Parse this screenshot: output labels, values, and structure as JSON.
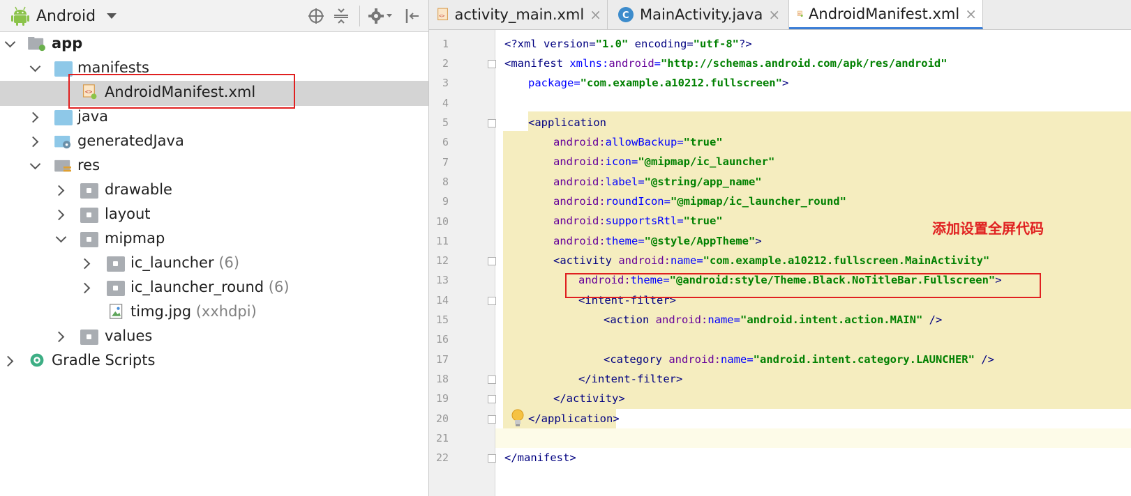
{
  "project_panel": {
    "view_label": "Android",
    "tree": [
      {
        "label": "app",
        "bold": true,
        "count": ""
      },
      {
        "label": "manifests",
        "count": ""
      },
      {
        "label": "AndroidManifest.xml",
        "count": ""
      },
      {
        "label": "java",
        "count": ""
      },
      {
        "label": "generatedJava",
        "count": ""
      },
      {
        "label": "res",
        "count": ""
      },
      {
        "label": "drawable",
        "count": ""
      },
      {
        "label": "layout",
        "count": ""
      },
      {
        "label": "mipmap",
        "count": ""
      },
      {
        "label": "ic_launcher",
        "count": "(6)"
      },
      {
        "label": "ic_launcher_round",
        "count": "(6)"
      },
      {
        "label": "timg.jpg",
        "count": "(xxhdpi)"
      },
      {
        "label": "values",
        "count": ""
      },
      {
        "label": "Gradle Scripts",
        "count": ""
      }
    ]
  },
  "editor": {
    "tabs": [
      {
        "label": "activity_main.xml",
        "close": "×"
      },
      {
        "label": "MainActivity.java",
        "close": "×"
      },
      {
        "label": "AndroidManifest.xml",
        "close": "×"
      }
    ],
    "active_tab": "AndroidManifest.xml",
    "line_numbers": [
      "1",
      "2",
      "3",
      "4",
      "5",
      "6",
      "7",
      "8",
      "9",
      "10",
      "11",
      "12",
      "13",
      "14",
      "15",
      "16",
      "17",
      "18",
      "19",
      "20",
      "21",
      "22"
    ],
    "code": {
      "l1": {
        "a": "<?xml version=",
        "b": "\"1.0\"",
        "c": " encoding=",
        "d": "\"utf-8\"",
        "e": "?>"
      },
      "l2": {
        "a": "<manifest ",
        "b": "xmlns:",
        "c": "android",
        "d": "=",
        "e": "\"http://schemas.android.com/apk/res/android\""
      },
      "l3": {
        "a": "package=",
        "b": "\"com.example.a10212.fullscreen\"",
        "c": ">"
      },
      "l5": {
        "a": "<application"
      },
      "l6": {
        "k": "android:",
        "n": "allowBackup",
        "eq": "=",
        "v": "\"true\""
      },
      "l7": {
        "k": "android:",
        "n": "icon",
        "eq": "=",
        "v": "\"@mipmap/ic_launcher\""
      },
      "l8": {
        "k": "android:",
        "n": "label",
        "eq": "=",
        "v": "\"@string/app_name\""
      },
      "l9": {
        "k": "android:",
        "n": "roundIcon",
        "eq": "=",
        "v": "\"@mipmap/ic_launcher_round\""
      },
      "l10": {
        "k": "android:",
        "n": "supportsRtl",
        "eq": "=",
        "v": "\"true\""
      },
      "l11": {
        "k": "android:",
        "n": "theme",
        "eq": "=",
        "v": "\"@style/AppTheme\"",
        "end": ">"
      },
      "l12": {
        "a": "<activity ",
        "k": "android:",
        "n": "name",
        "eq": "=",
        "v": "\"com.example.a10212.fullscreen.MainActivity\""
      },
      "l13": {
        "k": "android:",
        "n": "theme",
        "eq": "=",
        "v": "\"@android:style/Theme.Black.NoTitleBar.Fullscreen\"",
        "end": ">"
      },
      "l14": {
        "a": "<intent-filter>"
      },
      "l15": {
        "a": "<action ",
        "k": "android:",
        "n": "name",
        "eq": "=",
        "v": "\"android.intent.action.MAIN\"",
        "end": " />"
      },
      "l17": {
        "a": "<category ",
        "k": "android:",
        "n": "name",
        "eq": "=",
        "v": "\"android.intent.category.LAUNCHER\"",
        "end": " />"
      },
      "l18": {
        "a": "</intent-filter>"
      },
      "l19": {
        "a": "</activity>"
      },
      "l20": {
        "a": "</application>"
      },
      "l22": {
        "a": "</manifest>"
      }
    }
  },
  "annotation": {
    "note": "添加设置全屏代码",
    "color": "#e02020"
  }
}
